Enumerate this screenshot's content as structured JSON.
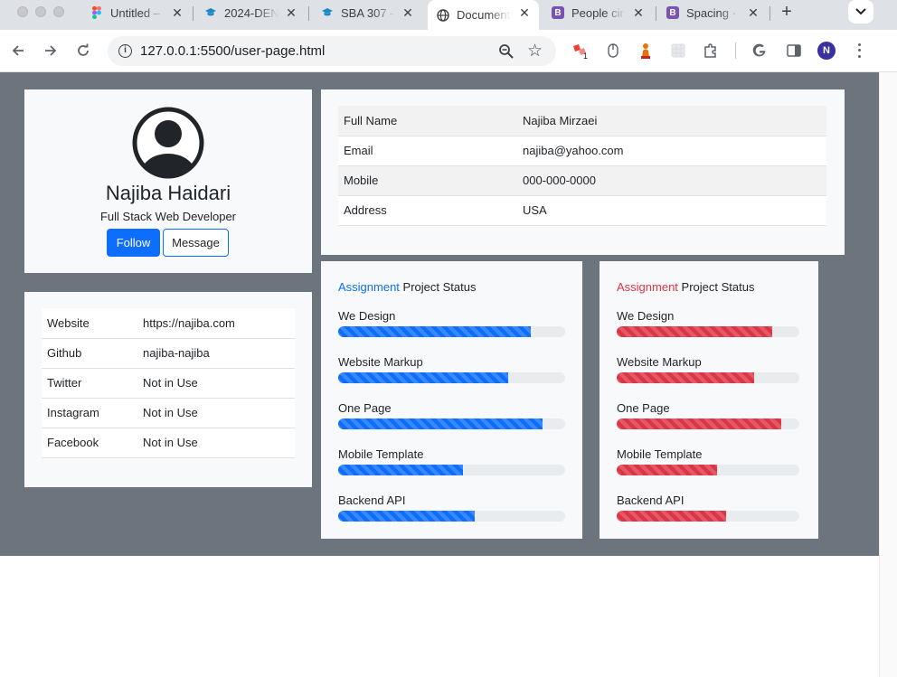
{
  "browser": {
    "tabs": [
      {
        "title": "Untitled –",
        "icon": "figma-icon"
      },
      {
        "title": "2024-DEN",
        "icon": "per-scholas-icon"
      },
      {
        "title": "SBA 307 –",
        "icon": "per-scholas-icon"
      },
      {
        "title": "Document",
        "icon": "globe-icon",
        "active": true
      },
      {
        "title": "People cir",
        "icon": "bootstrap-icon"
      },
      {
        "title": "Spacing ·",
        "icon": "bootstrap-icon"
      }
    ],
    "url": "127.0.0.1:5500/user-page.html",
    "profile_initial": "N",
    "extension_badge": "1"
  },
  "profile": {
    "name": "Najiba Haidari",
    "role": "Full Stack Web Developer",
    "follow_label": "Follow",
    "message_label": "Message"
  },
  "info": [
    {
      "label": "Full Name",
      "value": "Najiba Mirzaei"
    },
    {
      "label": "Email",
      "value": "najiba@yahoo.com"
    },
    {
      "label": "Mobile",
      "value": "000-000-0000"
    },
    {
      "label": "Address",
      "value": "USA"
    }
  ],
  "social": [
    {
      "label": "Website",
      "value": "https://najiba.com"
    },
    {
      "label": "Github",
      "value": "najiba-najiba"
    },
    {
      "label": "Twitter",
      "value": "Not in Use"
    },
    {
      "label": "Instagram",
      "value": "Not in Use"
    },
    {
      "label": "Facebook",
      "value": "Not in Use"
    }
  ],
  "status_blue": {
    "accent": "Assignment",
    "rest": " Project Status",
    "color": "#0d6efd",
    "items": [
      {
        "label": "We Design",
        "percent": 85
      },
      {
        "label": "Website Markup",
        "percent": 75
      },
      {
        "label": "One Page",
        "percent": 90
      },
      {
        "label": "Mobile Template",
        "percent": 55
      },
      {
        "label": "Backend API",
        "percent": 60
      }
    ]
  },
  "status_red": {
    "accent": "Assignment",
    "rest": " Project Status",
    "color": "#dc3545",
    "items": [
      {
        "label": "We Design",
        "percent": 85
      },
      {
        "label": "Website Markup",
        "percent": 75
      },
      {
        "label": "One Page",
        "percent": 90
      },
      {
        "label": "Mobile Template",
        "percent": 55
      },
      {
        "label": "Backend API",
        "percent": 60
      }
    ]
  },
  "colors": {
    "page_bg": "#6c757d",
    "card_bg": "#f8f9fa",
    "primary": "#0d6efd",
    "danger": "#dc3545"
  }
}
